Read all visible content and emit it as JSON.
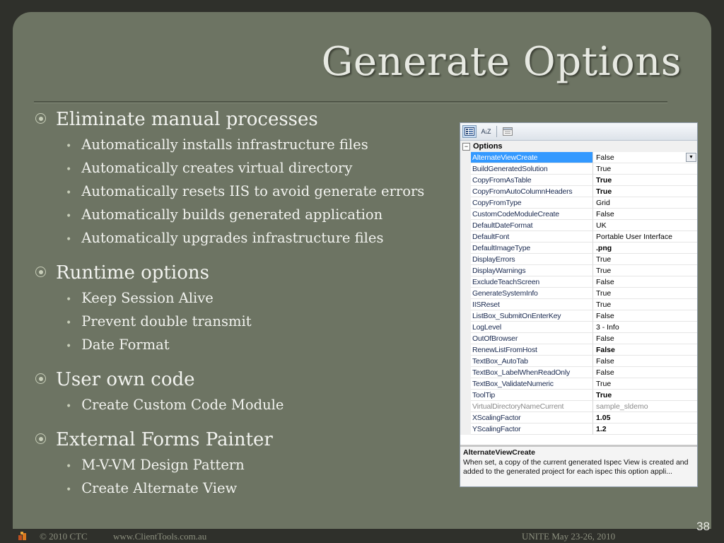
{
  "slide": {
    "title": "Generate Options",
    "page_number": "38"
  },
  "bullets": [
    {
      "label": "Eliminate manual processes",
      "items": [
        "Automatically installs infrastructure files",
        "Automatically creates virtual directory",
        "Automatically resets IIS to avoid generate errors",
        "Automatically builds generated application",
        "Automatically upgrades infrastructure files"
      ]
    },
    {
      "label": "Runtime options",
      "items": [
        "Keep Session Alive",
        "Prevent double transmit",
        "Date Format"
      ]
    },
    {
      "label": "User own code",
      "items": [
        "Create Custom Code Module"
      ]
    },
    {
      "label": "External Forms Painter",
      "items": [
        "M-V-VM Design Pattern",
        "Create Alternate View"
      ]
    }
  ],
  "property_grid": {
    "toolbar": {
      "categorized_icon": "categorized-icon",
      "alphabetical_icon": "alphabetical-sort-icon",
      "alphabetical_glyph": "A↓Z",
      "property_pages_icon": "property-pages-icon"
    },
    "category": "Options",
    "category_toggle": "⊟",
    "rows": [
      {
        "name": "AlternateViewCreate",
        "value": "False",
        "bold": false,
        "selected": true,
        "disabled": false
      },
      {
        "name": "BuildGeneratedSolution",
        "value": "True",
        "bold": false,
        "selected": false,
        "disabled": false
      },
      {
        "name": "CopyFromAsTable",
        "value": "True",
        "bold": true,
        "selected": false,
        "disabled": false
      },
      {
        "name": "CopyFromAutoColumnHeaders",
        "value": "True",
        "bold": true,
        "selected": false,
        "disabled": false
      },
      {
        "name": "CopyFromType",
        "value": "Grid",
        "bold": false,
        "selected": false,
        "disabled": false
      },
      {
        "name": "CustomCodeModuleCreate",
        "value": "False",
        "bold": false,
        "selected": false,
        "disabled": false
      },
      {
        "name": "DefaultDateFormat",
        "value": "UK",
        "bold": false,
        "selected": false,
        "disabled": false
      },
      {
        "name": "DefaultFont",
        "value": "Portable User Interface",
        "bold": false,
        "selected": false,
        "disabled": false
      },
      {
        "name": "DefaultImageType",
        "value": ".png",
        "bold": true,
        "selected": false,
        "disabled": false
      },
      {
        "name": "DisplayErrors",
        "value": "True",
        "bold": false,
        "selected": false,
        "disabled": false
      },
      {
        "name": "DisplayWarnings",
        "value": "True",
        "bold": false,
        "selected": false,
        "disabled": false
      },
      {
        "name": "ExcludeTeachScreen",
        "value": "False",
        "bold": false,
        "selected": false,
        "disabled": false
      },
      {
        "name": "GenerateSystemInfo",
        "value": "True",
        "bold": false,
        "selected": false,
        "disabled": false
      },
      {
        "name": "IISReset",
        "value": "True",
        "bold": false,
        "selected": false,
        "disabled": false
      },
      {
        "name": "ListBox_SubmitOnEnterKey",
        "value": "False",
        "bold": false,
        "selected": false,
        "disabled": false
      },
      {
        "name": "LogLevel",
        "value": "3 - Info",
        "bold": false,
        "selected": false,
        "disabled": false
      },
      {
        "name": "OutOfBrowser",
        "value": "False",
        "bold": false,
        "selected": false,
        "disabled": false
      },
      {
        "name": "RenewListFromHost",
        "value": "False",
        "bold": true,
        "selected": false,
        "disabled": false
      },
      {
        "name": "TextBox_AutoTab",
        "value": "False",
        "bold": false,
        "selected": false,
        "disabled": false
      },
      {
        "name": "TextBox_LabelWhenReadOnly",
        "value": "False",
        "bold": false,
        "selected": false,
        "disabled": false
      },
      {
        "name": "TextBox_ValidateNumeric",
        "value": "True",
        "bold": false,
        "selected": false,
        "disabled": false
      },
      {
        "name": "ToolTip",
        "value": "True",
        "bold": true,
        "selected": false,
        "disabled": false
      },
      {
        "name": "VirtualDirectoryNameCurrent",
        "value": "sample_sldemo",
        "bold": false,
        "selected": false,
        "disabled": true
      },
      {
        "name": "XScalingFactor",
        "value": "1.05",
        "bold": true,
        "selected": false,
        "disabled": false
      },
      {
        "name": "YScalingFactor",
        "value": "1.2",
        "bold": true,
        "selected": false,
        "disabled": false
      }
    ],
    "dropdown_glyph": "▼",
    "description": {
      "title": "AlternateViewCreate",
      "text": "When set, a copy of the current generated Ispec View is created and added to the generated project for each ispec this option appli..."
    }
  },
  "footer": {
    "copyright": "© 2010 CTC",
    "url": "www.ClientTools.com.au",
    "event": "UNITE May 23-26, 2010",
    "logo_icon": "ctc-logo-icon"
  },
  "colors": {
    "background": "#2f302b",
    "slide": "#6d7463",
    "text": "#f2f3ef",
    "selection": "#3399ff"
  }
}
